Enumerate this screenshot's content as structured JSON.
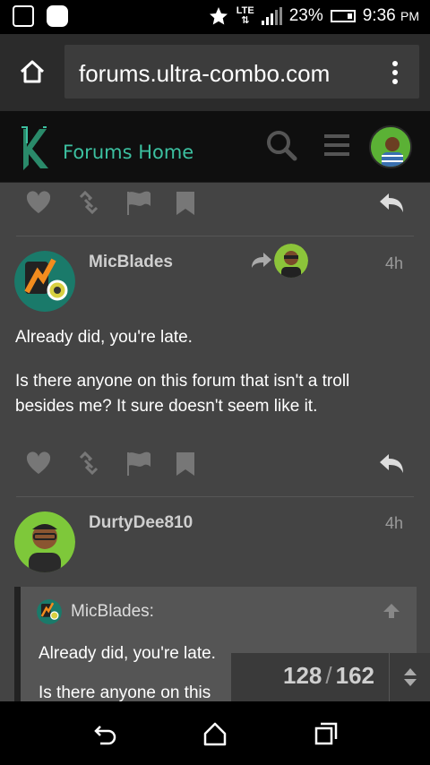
{
  "status_bar": {
    "network": "LTE",
    "battery": "23%",
    "time": "9:36",
    "ampm": "PM"
  },
  "browser": {
    "url": "forums.ultra-combo.com"
  },
  "site_header": {
    "title": "Forums Home"
  },
  "posts": [
    {
      "username": "MicBlades",
      "time": "4h",
      "paragraphs": [
        "Already did, you're late.",
        "Is there anyone on this forum that isn't a troll besides me? It sure doesn't seem like it."
      ]
    },
    {
      "username": "DurtyDee810",
      "time": "4h",
      "quote": {
        "author": "MicBlades:",
        "lines": [
          "Already did, you're late.",
          "Is there anyone on this"
        ]
      }
    }
  ],
  "progress": {
    "current": "128",
    "separator": "/",
    "total": "162"
  },
  "colors": {
    "background": "#444444",
    "header": "#0f0f0f",
    "accent": "#3cc0a0",
    "avatar_green": "#5bb135"
  }
}
